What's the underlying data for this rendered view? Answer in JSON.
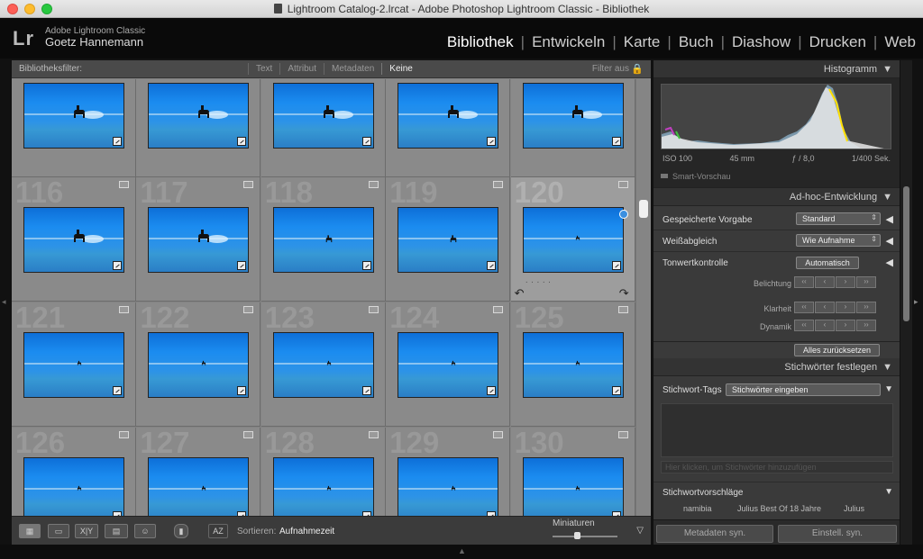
{
  "window": {
    "title": "Lightroom Catalog-2.lrcat - Adobe Photoshop Lightroom Classic - Bibliothek"
  },
  "identity": {
    "logo": "Lr",
    "product": "Adobe Lightroom Classic",
    "user": "Goetz Hannemann"
  },
  "modules": [
    "Bibliothek",
    "Entwickeln",
    "Karte",
    "Buch",
    "Diashow",
    "Drucken",
    "Web"
  ],
  "active_module": "Bibliothek",
  "filter": {
    "label": "Bibliotheksfilter:",
    "tabs": [
      "Text",
      "Attribut",
      "Metadaten",
      "Keine"
    ],
    "active": "Keine",
    "status": "Filter aus"
  },
  "grid": {
    "rows": [
      {
        "numbers": [
          "",
          "",
          "",
          "",
          ""
        ]
      },
      {
        "numbers": [
          "116",
          "117",
          "118",
          "119",
          "120"
        ]
      },
      {
        "numbers": [
          "121",
          "122",
          "123",
          "124",
          "125"
        ]
      },
      {
        "numbers": [
          "126",
          "127",
          "128",
          "129",
          "130"
        ]
      }
    ],
    "selected": "120"
  },
  "toolbar": {
    "sort_label": "Sortieren:",
    "sort_value": "Aufnahmezeit",
    "thumb_label": "Miniaturen",
    "buttons": [
      "grid-view",
      "loupe-view",
      "compare-view",
      "survey-view",
      "people-view"
    ],
    "compare_text": "X|Y",
    "thumbnail_size": 0.38
  },
  "histogram": {
    "title": "Histogramm",
    "iso": "ISO 100",
    "focal": "45 mm",
    "aperture": "ƒ / 8,0",
    "shutter": "1/400 Sek.",
    "smart_preview": "Smart-Vorschau"
  },
  "quick_develop": {
    "title": "Ad-hoc-Entwicklung",
    "preset_label": "Gespeicherte Vorgabe",
    "preset_value": "Standard",
    "wb_label": "Weißabgleich",
    "wb_value": "Wie Aufnahme",
    "tone_label": "Tonwertkontrolle",
    "auto_label": "Automatisch",
    "exposure_label": "Belichtung",
    "clarity_label": "Klarheit",
    "vibrance_label": "Dynamik",
    "reset_label": "Alles zurücksetzen"
  },
  "keywording": {
    "title": "Stichwörter festlegen",
    "tags_label": "Stichwort-Tags",
    "tags_value": "Stichwörter eingeben",
    "hint": "Hier klicken, um Stichwörter hinzuzufügen",
    "suggestions_label": "Stichwortvorschläge",
    "suggestions": [
      "namibia",
      "Julius Best Of 18 Jahre",
      "Julius"
    ]
  },
  "sync": {
    "metadata": "Metadaten syn.",
    "settings": "Einstell. syn."
  },
  "colors": {
    "accent": "#e0a000",
    "photo_blue": "#1b8cf0",
    "panel": "#2d2d2d",
    "grid_bg": "#838383"
  }
}
